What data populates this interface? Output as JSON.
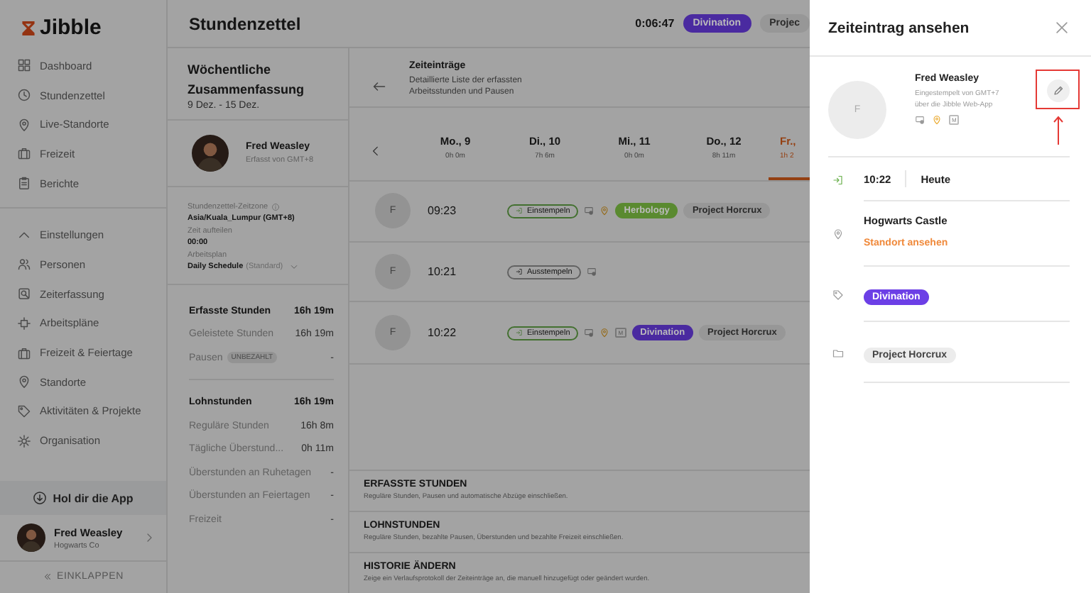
{
  "sidebar": {
    "logo": "Jibble",
    "nav": [
      {
        "label": "Dashboard"
      },
      {
        "label": "Stundenzettel"
      },
      {
        "label": "Live-Standorte"
      },
      {
        "label": "Freizeit"
      },
      {
        "label": "Berichte"
      }
    ],
    "settings": {
      "label": "Einstellungen",
      "expanded": true,
      "items": [
        {
          "label": "Personen"
        },
        {
          "label": "Zeiterfassung"
        },
        {
          "label": "Arbeitspläne"
        },
        {
          "label": "Freizeit & Feiertage"
        },
        {
          "label": "Standorte"
        },
        {
          "label": "Aktivitäten & Projekte"
        },
        {
          "label": "Organisation"
        }
      ]
    },
    "app_button": "Hol dir die App",
    "user": {
      "name": "Fred Weasley",
      "org": "Hogwarts Co"
    },
    "collapse": "EINKLAPPEN"
  },
  "topbar": {
    "title": "Stundenzettel",
    "timer": "0:06:47",
    "tags": [
      {
        "label": "Divination",
        "kind": "activity",
        "color": "#4a2aa0"
      },
      {
        "label": "Projec",
        "kind": "project"
      }
    ]
  },
  "summary": {
    "title": "Wöchentliche Zusammenfassung",
    "range": "9 Dez. - 15 Dez.",
    "person": {
      "name": "Fred Weasley",
      "note": "Erfasst von GMT+8"
    },
    "settings": [
      {
        "label": "Stundenzettel-Zeitzone",
        "info": true,
        "value": "Asia/Kuala_Lumpur (GMT+8)"
      },
      {
        "label": "Zeit aufteilen",
        "value": "00:00"
      },
      {
        "label": "Arbeitsplan",
        "value": "Daily Schedule",
        "hint": "(Standard)",
        "dropdown": true
      }
    ],
    "stat_groups": [
      {
        "rows": [
          {
            "kind": "total",
            "label": "Erfasste Stunden",
            "value": "16h 19m"
          },
          {
            "kind": "line",
            "label": "Geleistete Stunden",
            "value": "16h 19m"
          },
          {
            "kind": "line",
            "label": "Pausen",
            "badge": "UNBEZAHLT",
            "value": "-"
          }
        ]
      },
      {
        "rows": [
          {
            "kind": "total",
            "label": "Lohnstunden",
            "value": "16h 19m"
          },
          {
            "kind": "line",
            "label": "Reguläre Stunden",
            "value": "16h 8m"
          },
          {
            "kind": "line",
            "label": "Tägliche Überstund...",
            "value": "0h 11m"
          },
          {
            "kind": "line",
            "label": "Überstunden an Ruhetagen",
            "value": "-"
          },
          {
            "kind": "line",
            "label": "Überstunden an Feiertagen",
            "value": "-"
          },
          {
            "kind": "line",
            "label": "Freizeit",
            "value": "-"
          }
        ]
      }
    ]
  },
  "entries": {
    "title": "Zeiteinträge",
    "description": "Detaillierte Liste der erfassten Arbeitsstunden und Pausen",
    "days": [
      {
        "day": "Mo., 9",
        "total": "0h 0m",
        "selected": false
      },
      {
        "day": "Di., 10",
        "total": "7h 6m",
        "selected": false
      },
      {
        "day": "Mi., 11",
        "total": "0h 0m",
        "selected": false
      },
      {
        "day": "Do., 12",
        "total": "8h 11m",
        "selected": false
      },
      {
        "day": "Fr.,",
        "total": "1h 2",
        "selected": true
      }
    ],
    "items": [
      {
        "initial": "F",
        "time": "09:23",
        "action": {
          "kind": "in",
          "label": "Einstempeln"
        },
        "location": true,
        "tags": [
          {
            "label": "Herbology",
            "kind": "activity",
            "color": "#5a8a30"
          },
          {
            "label": "Project Horcrux",
            "kind": "project"
          }
        ]
      },
      {
        "initial": "F",
        "time": "10:21",
        "action": {
          "kind": "out",
          "label": "Ausstempeln"
        },
        "location": false
      },
      {
        "initial": "F",
        "time": "10:22",
        "action": {
          "kind": "in",
          "label": "Einstempeln"
        },
        "location": true,
        "manual": "M",
        "tags": [
          {
            "label": "Divination",
            "kind": "activity",
            "color": "#4a2aa0"
          },
          {
            "label": "Project Horcrux",
            "kind": "project"
          }
        ]
      }
    ],
    "sections": [
      {
        "title": "ERFASSTE STUNDEN",
        "description": "Reguläre Stunden, Pausen und automatische Abzüge einschließen."
      },
      {
        "title": "LOHNSTUNDEN",
        "description": "Reguläre Stunden, bezahlte Pausen, Überstunden und bezahlte Freizeit einschließen."
      },
      {
        "title": "HISTORIE ÄNDERN",
        "description": "Zeige ein Verlaufsprotokoll der Zeiteinträge an, die manuell hinzugefügt oder geändert wurden."
      }
    ]
  },
  "drawer": {
    "title": "Zeiteintrag ansehen",
    "person": {
      "initial": "F",
      "name": "Fred Weasley",
      "lines": [
        "Eingestempelt von GMT+7",
        "über die Jibble Web-App"
      ],
      "location": true,
      "manual": "M"
    },
    "highlight_edit": true,
    "time": "10:22",
    "day": "Heute",
    "location": {
      "name": "Hogwarts Castle",
      "link": "Standort ansehen"
    },
    "activity": {
      "label": "Divination",
      "color": "#6c3fe6"
    },
    "project": "Project Horcrux"
  }
}
